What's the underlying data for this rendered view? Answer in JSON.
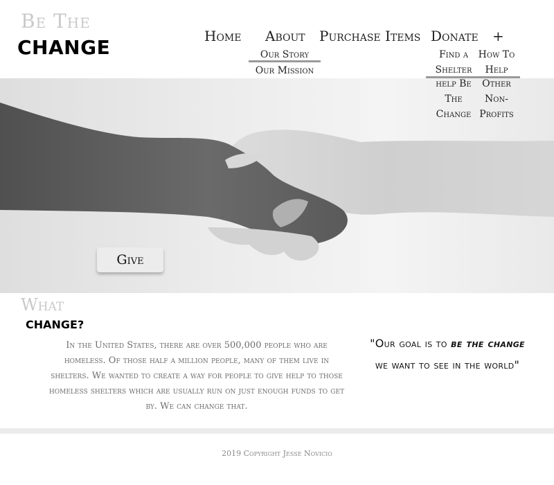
{
  "brand": {
    "line1": "Be The",
    "line2": "CHANGE"
  },
  "nav": {
    "home": "Home",
    "about": "About",
    "purchase": "Purchase Items",
    "donate": "Donate",
    "more": "+",
    "about_sub": [
      "Our Story",
      "Our Mission"
    ],
    "donate_sub_col1": [
      "Find a",
      "Shelter",
      "help Be",
      "The",
      "Change"
    ],
    "donate_sub_col2": [
      "How To",
      "Help",
      "Other",
      "Non-",
      "Profits"
    ]
  },
  "hero": {
    "button_label": "Give",
    "image": "handshake-photo",
    "tone": "grayscale"
  },
  "what": {
    "heading_line1": "What",
    "heading_line2": "CHANGE?",
    "body": "In the United States, there are over 500,000 people who  are homeless. Of those half a million people, many of them live in shelters. We wanted to create a way for people to give help to those homeless shelters which are usually run on just enough funds to get by. We can change that."
  },
  "quote": {
    "open": "\"Our goal is to ",
    "emphasis": "be the change",
    "close": " we want to see in the world\""
  },
  "footer": {
    "copyright": "2019 Copyright Jesse Novicio"
  },
  "colors": {
    "divider": "#ececec",
    "nav_rule": "#9a9a9a",
    "muted_text": "#6d6d6d"
  }
}
